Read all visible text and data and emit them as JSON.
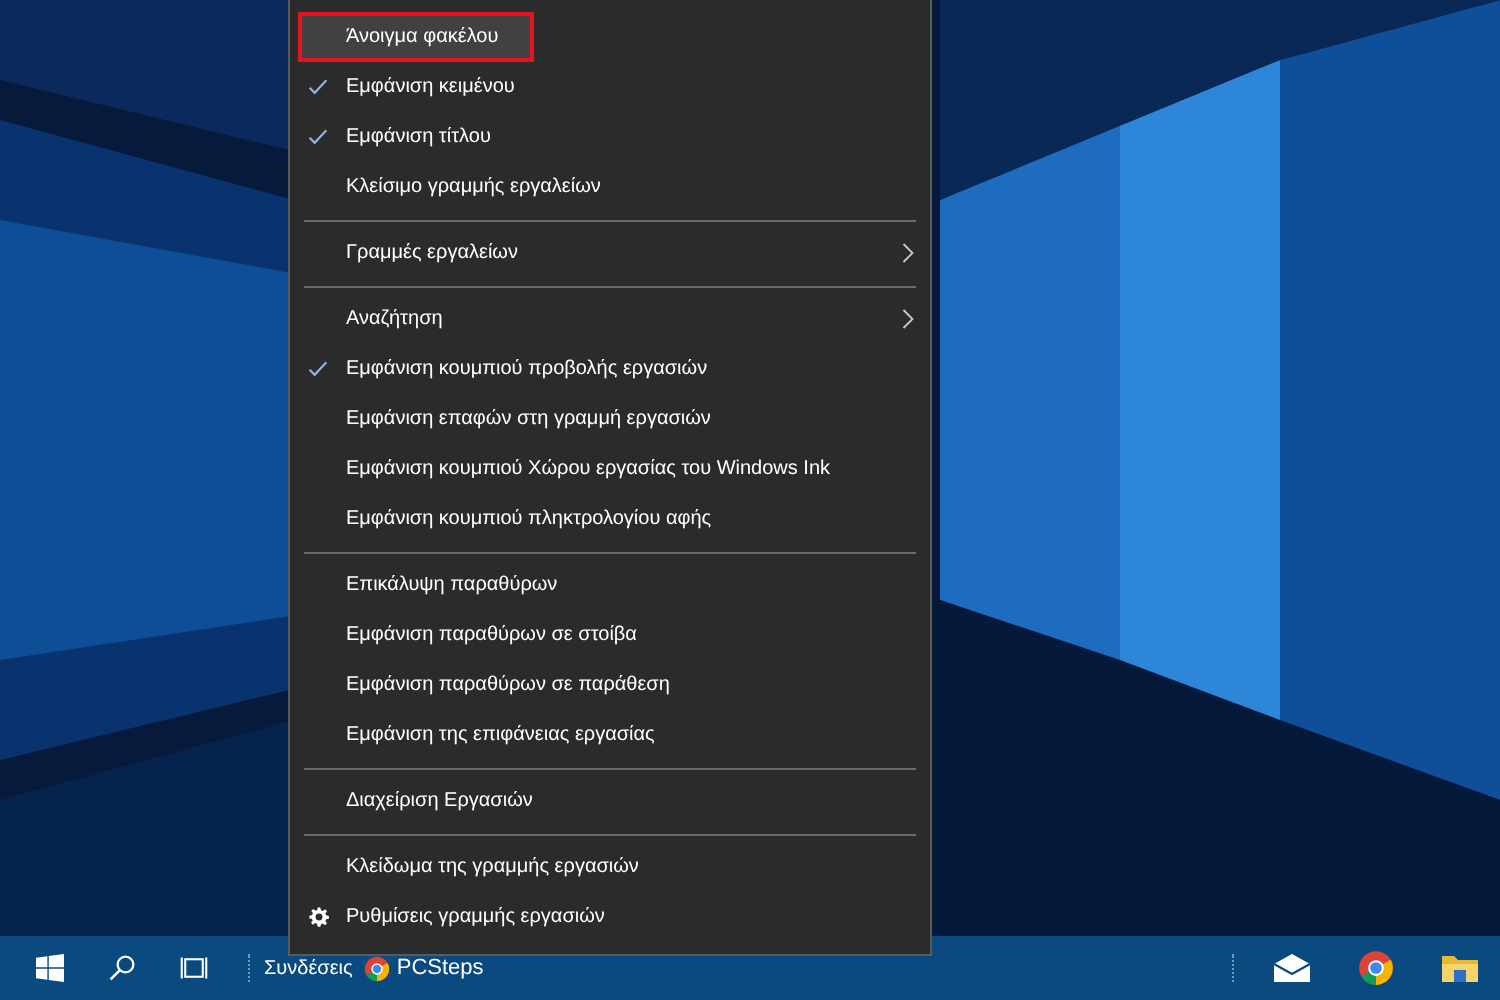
{
  "context_menu": {
    "items": [
      {
        "kind": "item",
        "label": "Άνοιγμα φακέλου",
        "selected": true,
        "annotated": true,
        "checked": false,
        "submenu": false
      },
      {
        "kind": "item",
        "label": "Εμφάνιση κειμένου",
        "selected": false,
        "annotated": false,
        "checked": true,
        "submenu": false
      },
      {
        "kind": "item",
        "label": "Εμφάνιση τίτλου",
        "selected": false,
        "annotated": false,
        "checked": true,
        "submenu": false
      },
      {
        "kind": "item",
        "label": "Κλείσιμο γραμμής εργαλείων",
        "selected": false,
        "annotated": false,
        "checked": false,
        "submenu": false
      },
      {
        "kind": "separator"
      },
      {
        "kind": "item",
        "label": "Γραμμές εργαλείων",
        "selected": false,
        "annotated": false,
        "checked": false,
        "submenu": true
      },
      {
        "kind": "separator"
      },
      {
        "kind": "item",
        "label": "Αναζήτηση",
        "selected": false,
        "annotated": false,
        "checked": false,
        "submenu": true
      },
      {
        "kind": "item",
        "label": "Εμφάνιση κουμπιού προβολής εργασιών",
        "selected": false,
        "annotated": false,
        "checked": true,
        "submenu": false
      },
      {
        "kind": "item",
        "label": "Εμφάνιση επαφών στη γραμμή εργασιών",
        "selected": false,
        "annotated": false,
        "checked": false,
        "submenu": false
      },
      {
        "kind": "item",
        "label": "Εμφάνιση κουμπιού Χώρου εργασίας του Windows Ink",
        "selected": false,
        "annotated": false,
        "checked": false,
        "submenu": false
      },
      {
        "kind": "item",
        "label": "Εμφάνιση κουμπιού πληκτρολογίου αφής",
        "selected": false,
        "annotated": false,
        "checked": false,
        "submenu": false
      },
      {
        "kind": "separator"
      },
      {
        "kind": "item",
        "label": "Επικάλυψη παραθύρων",
        "selected": false,
        "annotated": false,
        "checked": false,
        "submenu": false
      },
      {
        "kind": "item",
        "label": "Εμφάνιση παραθύρων σε στοίβα",
        "selected": false,
        "annotated": false,
        "checked": false,
        "submenu": false
      },
      {
        "kind": "item",
        "label": "Εμφάνιση παραθύρων σε παράθεση",
        "selected": false,
        "annotated": false,
        "checked": false,
        "submenu": false
      },
      {
        "kind": "item",
        "label": "Εμφάνιση της επιφάνειας εργασίας",
        "selected": false,
        "annotated": false,
        "checked": false,
        "submenu": false
      },
      {
        "kind": "separator"
      },
      {
        "kind": "item",
        "label": "Διαχείριση Εργασιών",
        "selected": false,
        "annotated": false,
        "checked": false,
        "submenu": false
      },
      {
        "kind": "separator"
      },
      {
        "kind": "item",
        "label": "Κλείδωμα της γραμμής εργασιών",
        "selected": false,
        "annotated": false,
        "checked": false,
        "submenu": false
      },
      {
        "kind": "settings_item",
        "label": "Ρυθμίσεις γραμμής εργασιών",
        "selected": false,
        "annotated": false,
        "checked": false,
        "submenu": false
      }
    ]
  },
  "taskbar": {
    "toolbar_label": "Συνδέσεις",
    "link": "PCSteps"
  }
}
